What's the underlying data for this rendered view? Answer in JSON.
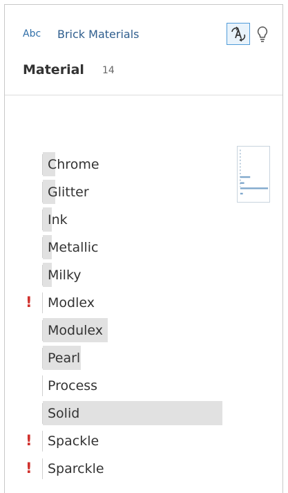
{
  "header": {
    "type_badge": "Abc",
    "source_name": "Brick Materials",
    "field_title": "Material",
    "field_count": "14",
    "recommend_icon": "recommendations-icon",
    "bulb_icon": "lightbulb-icon"
  },
  "values": [
    {
      "label": "Chrome",
      "warning": false,
      "fraction": 0.07
    },
    {
      "label": "Glitter",
      "warning": false,
      "fraction": 0.07
    },
    {
      "label": "Ink",
      "warning": false,
      "fraction": 0.05
    },
    {
      "label": "Metallic",
      "warning": false,
      "fraction": 0.05
    },
    {
      "label": "Milky",
      "warning": false,
      "fraction": 0.05
    },
    {
      "label": "Modlex",
      "warning": true,
      "fraction": 0.0
    },
    {
      "label": "Modulex",
      "warning": false,
      "fraction": 0.36
    },
    {
      "label": "Pearl",
      "warning": false,
      "fraction": 0.21
    },
    {
      "label": "Process",
      "warning": false,
      "fraction": 0.0
    },
    {
      "label": "Solid",
      "warning": false,
      "fraction": 1.0
    },
    {
      "label": "Spackle",
      "warning": true,
      "fraction": 0.0
    },
    {
      "label": "Sparckle",
      "warning": true,
      "fraction": 0.0
    }
  ],
  "warning_symbol": "!",
  "colors": {
    "bar": "#e1e1e1",
    "warning": "#d0312d",
    "accent": "#4f9bd9"
  }
}
